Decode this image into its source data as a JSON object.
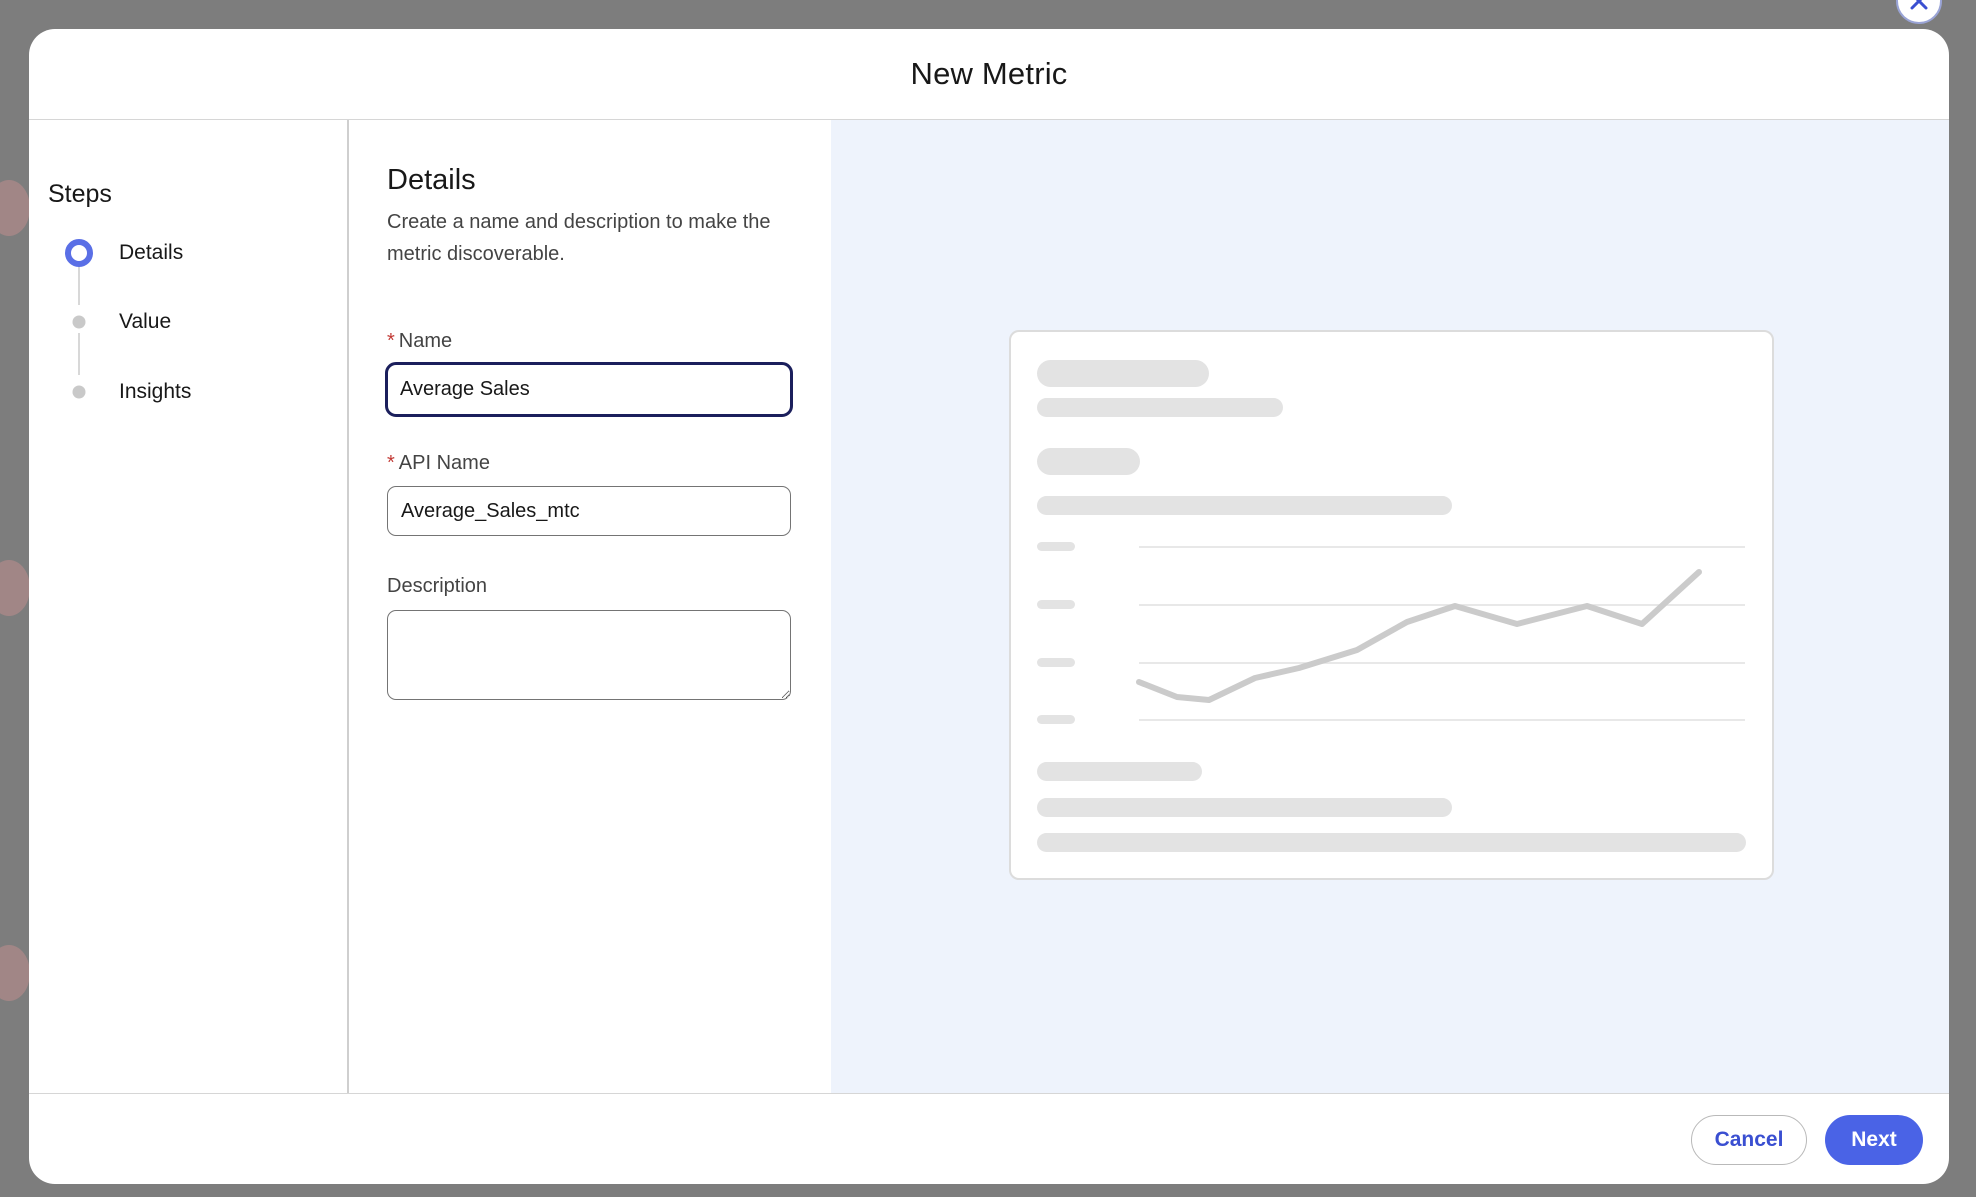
{
  "modal": {
    "title": "New Metric"
  },
  "steps": {
    "heading": "Steps",
    "items": [
      {
        "label": "Details",
        "state": "current"
      },
      {
        "label": "Value",
        "state": "upcoming"
      },
      {
        "label": "Insights",
        "state": "upcoming"
      }
    ]
  },
  "details": {
    "title": "Details",
    "description": "Create a name and description to make the metric discoverable.",
    "required_marker": "*",
    "name_label": "Name",
    "name_value": "Average Sales",
    "api_name_label": "API Name",
    "api_name_value": "Average_Sales_mtc",
    "description_label": "Description",
    "description_value": ""
  },
  "footer": {
    "cancel_label": "Cancel",
    "next_label": "Next"
  },
  "colors": {
    "accent": "#4a63e6",
    "preview_background": "#eef3fc",
    "required": "#c23934"
  },
  "icons": {
    "close": "close-icon",
    "resize": "resize-handle-icon"
  }
}
